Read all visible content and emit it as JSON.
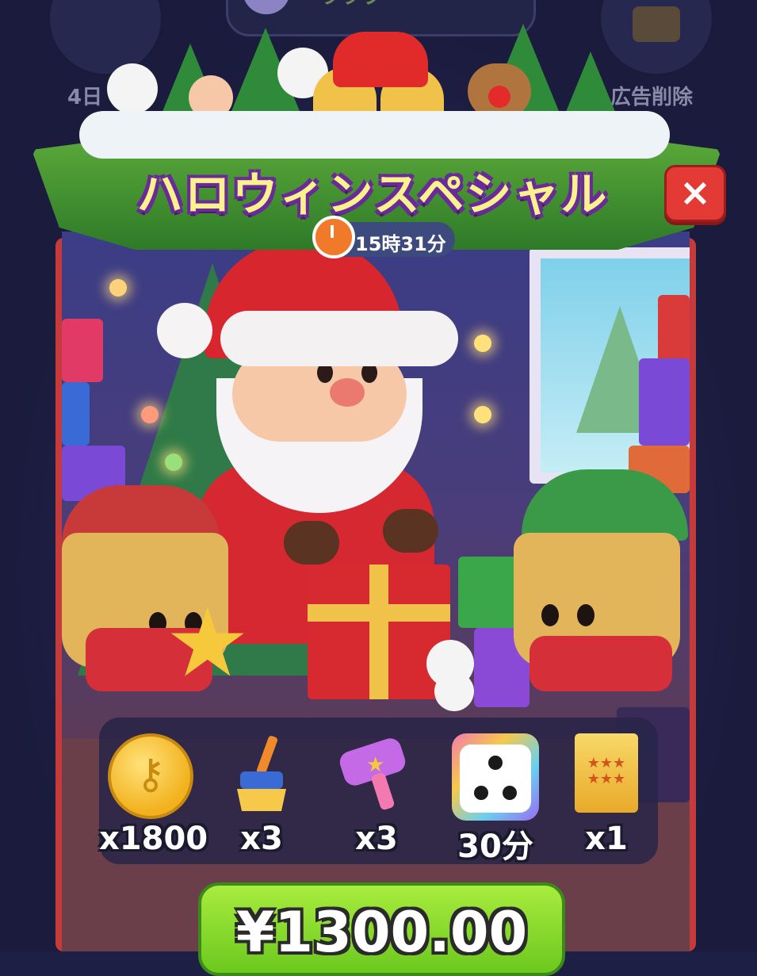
{
  "background": {
    "left_button_label": "4日",
    "right_button_label": "広告削除",
    "right_button_icon": "ads-icon",
    "top_pill_text": "ラララ"
  },
  "popup": {
    "title": "ハロウィンスペシャル",
    "close_label": "×",
    "timer_text": "15時31分"
  },
  "rewards": [
    {
      "icon": "coin-icon",
      "label": "x1800"
    },
    {
      "icon": "broom-icon",
      "label": "x3"
    },
    {
      "icon": "hammer-icon",
      "label": "x3"
    },
    {
      "icon": "dice-icon",
      "label": "30分"
    },
    {
      "icon": "sticker-pack-icon",
      "label": "x1"
    }
  ],
  "purchase": {
    "price": "¥1300.00"
  },
  "colors": {
    "banner_green": "#3e8f2e",
    "title_yellow": "#fbf18d",
    "title_outline": "#6b2a9a",
    "close_red": "#e43a36",
    "price_green": "#8bd92e",
    "frame_red": "#c53a3a"
  }
}
